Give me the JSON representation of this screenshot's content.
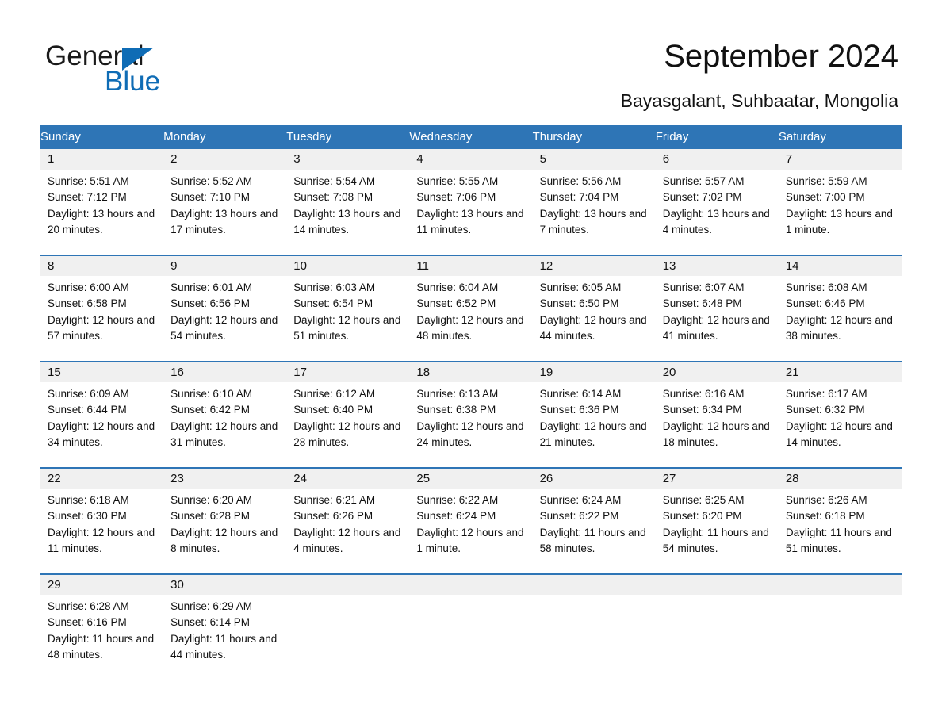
{
  "brand": {
    "name_part1": "General",
    "name_part2": "Blue",
    "accent_color": "#0f6cb5"
  },
  "header": {
    "title": "September 2024",
    "location": "Bayasgalant, Suhbaatar, Mongolia"
  },
  "theme": {
    "header_blue": "#2e75b6",
    "daynum_gray": "#f0f0f0",
    "cell_white": "#ffffff"
  },
  "weekdays": [
    "Sunday",
    "Monday",
    "Tuesday",
    "Wednesday",
    "Thursday",
    "Friday",
    "Saturday"
  ],
  "weeks": [
    [
      {
        "day": "1",
        "sunrise": "Sunrise: 5:51 AM",
        "sunset": "Sunset: 7:12 PM",
        "daylight": "Daylight: 13 hours and 20 minutes."
      },
      {
        "day": "2",
        "sunrise": "Sunrise: 5:52 AM",
        "sunset": "Sunset: 7:10 PM",
        "daylight": "Daylight: 13 hours and 17 minutes."
      },
      {
        "day": "3",
        "sunrise": "Sunrise: 5:54 AM",
        "sunset": "Sunset: 7:08 PM",
        "daylight": "Daylight: 13 hours and 14 minutes."
      },
      {
        "day": "4",
        "sunrise": "Sunrise: 5:55 AM",
        "sunset": "Sunset: 7:06 PM",
        "daylight": "Daylight: 13 hours and 11 minutes."
      },
      {
        "day": "5",
        "sunrise": "Sunrise: 5:56 AM",
        "sunset": "Sunset: 7:04 PM",
        "daylight": "Daylight: 13 hours and 7 minutes."
      },
      {
        "day": "6",
        "sunrise": "Sunrise: 5:57 AM",
        "sunset": "Sunset: 7:02 PM",
        "daylight": "Daylight: 13 hours and 4 minutes."
      },
      {
        "day": "7",
        "sunrise": "Sunrise: 5:59 AM",
        "sunset": "Sunset: 7:00 PM",
        "daylight": "Daylight: 13 hours and 1 minute."
      }
    ],
    [
      {
        "day": "8",
        "sunrise": "Sunrise: 6:00 AM",
        "sunset": "Sunset: 6:58 PM",
        "daylight": "Daylight: 12 hours and 57 minutes."
      },
      {
        "day": "9",
        "sunrise": "Sunrise: 6:01 AM",
        "sunset": "Sunset: 6:56 PM",
        "daylight": "Daylight: 12 hours and 54 minutes."
      },
      {
        "day": "10",
        "sunrise": "Sunrise: 6:03 AM",
        "sunset": "Sunset: 6:54 PM",
        "daylight": "Daylight: 12 hours and 51 minutes."
      },
      {
        "day": "11",
        "sunrise": "Sunrise: 6:04 AM",
        "sunset": "Sunset: 6:52 PM",
        "daylight": "Daylight: 12 hours and 48 minutes."
      },
      {
        "day": "12",
        "sunrise": "Sunrise: 6:05 AM",
        "sunset": "Sunset: 6:50 PM",
        "daylight": "Daylight: 12 hours and 44 minutes."
      },
      {
        "day": "13",
        "sunrise": "Sunrise: 6:07 AM",
        "sunset": "Sunset: 6:48 PM",
        "daylight": "Daylight: 12 hours and 41 minutes."
      },
      {
        "day": "14",
        "sunrise": "Sunrise: 6:08 AM",
        "sunset": "Sunset: 6:46 PM",
        "daylight": "Daylight: 12 hours and 38 minutes."
      }
    ],
    [
      {
        "day": "15",
        "sunrise": "Sunrise: 6:09 AM",
        "sunset": "Sunset: 6:44 PM",
        "daylight": "Daylight: 12 hours and 34 minutes."
      },
      {
        "day": "16",
        "sunrise": "Sunrise: 6:10 AM",
        "sunset": "Sunset: 6:42 PM",
        "daylight": "Daylight: 12 hours and 31 minutes."
      },
      {
        "day": "17",
        "sunrise": "Sunrise: 6:12 AM",
        "sunset": "Sunset: 6:40 PM",
        "daylight": "Daylight: 12 hours and 28 minutes."
      },
      {
        "day": "18",
        "sunrise": "Sunrise: 6:13 AM",
        "sunset": "Sunset: 6:38 PM",
        "daylight": "Daylight: 12 hours and 24 minutes."
      },
      {
        "day": "19",
        "sunrise": "Sunrise: 6:14 AM",
        "sunset": "Sunset: 6:36 PM",
        "daylight": "Daylight: 12 hours and 21 minutes."
      },
      {
        "day": "20",
        "sunrise": "Sunrise: 6:16 AM",
        "sunset": "Sunset: 6:34 PM",
        "daylight": "Daylight: 12 hours and 18 minutes."
      },
      {
        "day": "21",
        "sunrise": "Sunrise: 6:17 AM",
        "sunset": "Sunset: 6:32 PM",
        "daylight": "Daylight: 12 hours and 14 minutes."
      }
    ],
    [
      {
        "day": "22",
        "sunrise": "Sunrise: 6:18 AM",
        "sunset": "Sunset: 6:30 PM",
        "daylight": "Daylight: 12 hours and 11 minutes."
      },
      {
        "day": "23",
        "sunrise": "Sunrise: 6:20 AM",
        "sunset": "Sunset: 6:28 PM",
        "daylight": "Daylight: 12 hours and 8 minutes."
      },
      {
        "day": "24",
        "sunrise": "Sunrise: 6:21 AM",
        "sunset": "Sunset: 6:26 PM",
        "daylight": "Daylight: 12 hours and 4 minutes."
      },
      {
        "day": "25",
        "sunrise": "Sunrise: 6:22 AM",
        "sunset": "Sunset: 6:24 PM",
        "daylight": "Daylight: 12 hours and 1 minute."
      },
      {
        "day": "26",
        "sunrise": "Sunrise: 6:24 AM",
        "sunset": "Sunset: 6:22 PM",
        "daylight": "Daylight: 11 hours and 58 minutes."
      },
      {
        "day": "27",
        "sunrise": "Sunrise: 6:25 AM",
        "sunset": "Sunset: 6:20 PM",
        "daylight": "Daylight: 11 hours and 54 minutes."
      },
      {
        "day": "28",
        "sunrise": "Sunrise: 6:26 AM",
        "sunset": "Sunset: 6:18 PM",
        "daylight": "Daylight: 11 hours and 51 minutes."
      }
    ],
    [
      {
        "day": "29",
        "sunrise": "Sunrise: 6:28 AM",
        "sunset": "Sunset: 6:16 PM",
        "daylight": "Daylight: 11 hours and 48 minutes."
      },
      {
        "day": "30",
        "sunrise": "Sunrise: 6:29 AM",
        "sunset": "Sunset: 6:14 PM",
        "daylight": "Daylight: 11 hours and 44 minutes."
      },
      {
        "day": "",
        "sunrise": "",
        "sunset": "",
        "daylight": ""
      },
      {
        "day": "",
        "sunrise": "",
        "sunset": "",
        "daylight": ""
      },
      {
        "day": "",
        "sunrise": "",
        "sunset": "",
        "daylight": ""
      },
      {
        "day": "",
        "sunrise": "",
        "sunset": "",
        "daylight": ""
      },
      {
        "day": "",
        "sunrise": "",
        "sunset": "",
        "daylight": ""
      }
    ]
  ]
}
